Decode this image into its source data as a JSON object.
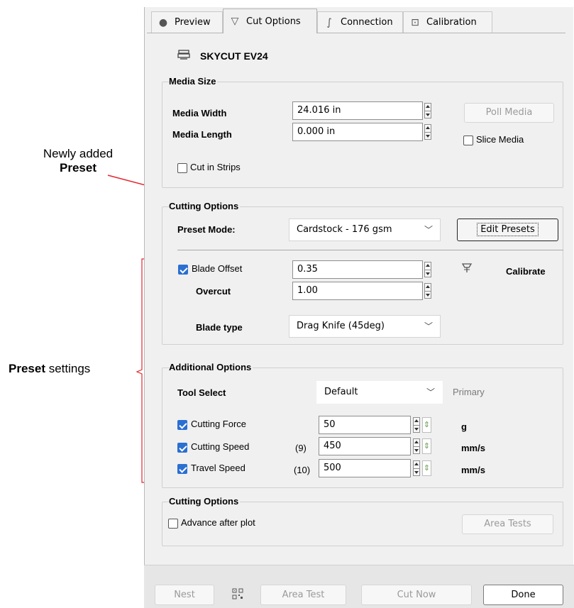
{
  "annotations": {
    "newly_added_line1": "Newly added",
    "newly_added_line2": "Preset",
    "preset_settings_bold": "Preset",
    "preset_settings_rest": " settings"
  },
  "tabs": [
    {
      "label": "Preview",
      "icon": "eye-icon"
    },
    {
      "label": "Cut Options",
      "icon": "blade-icon"
    },
    {
      "label": "Connection",
      "icon": "cable-icon"
    },
    {
      "label": "Calibration",
      "icon": "calibration-icon"
    }
  ],
  "device": {
    "name": "SKYCUT EV24",
    "icon": "printer-icon"
  },
  "media_size": {
    "title": "Media Size",
    "width_label": "Media Width",
    "width_value": "24.016 in",
    "length_label": "Media Length",
    "length_value": "0.000 in",
    "poll_button": "Poll Media",
    "slice_label": "Slice Media",
    "strips_label": "Cut in Strips"
  },
  "cutting_options": {
    "title": "Cutting Options",
    "preset_label": "Preset Mode:",
    "preset_value": "Cardstock - 176 gsm",
    "edit_presets": "Edit Presets",
    "blade_offset_label": "Blade Offset",
    "blade_offset_value": "0.35",
    "overcut_label": "Overcut",
    "overcut_value": "1.00",
    "calibrate_label": "Calibrate",
    "blade_type_label": "Blade type",
    "blade_type_value": "Drag Knife (45deg)"
  },
  "additional_options": {
    "title": "Additional Options",
    "tool_select_label": "Tool Select",
    "tool_select_value": "Default",
    "primary_label": "Primary",
    "force_label": "Cutting Force",
    "force_value": "50",
    "force_unit": "g",
    "speed_label": "Cutting Speed",
    "speed_index": "(9)",
    "speed_value": "450",
    "speed_unit": "mm/s",
    "travel_label": "Travel Speed",
    "travel_index": "(10)",
    "travel_value": "500",
    "travel_unit": "mm/s"
  },
  "cutting_options_2": {
    "title": "Cutting Options",
    "advance_label": "Advance after plot",
    "area_tests": "Area Tests"
  },
  "bottom": {
    "nest": "Nest",
    "area_test": "Area Test",
    "cut_now": "Cut Now",
    "done": "Done"
  }
}
